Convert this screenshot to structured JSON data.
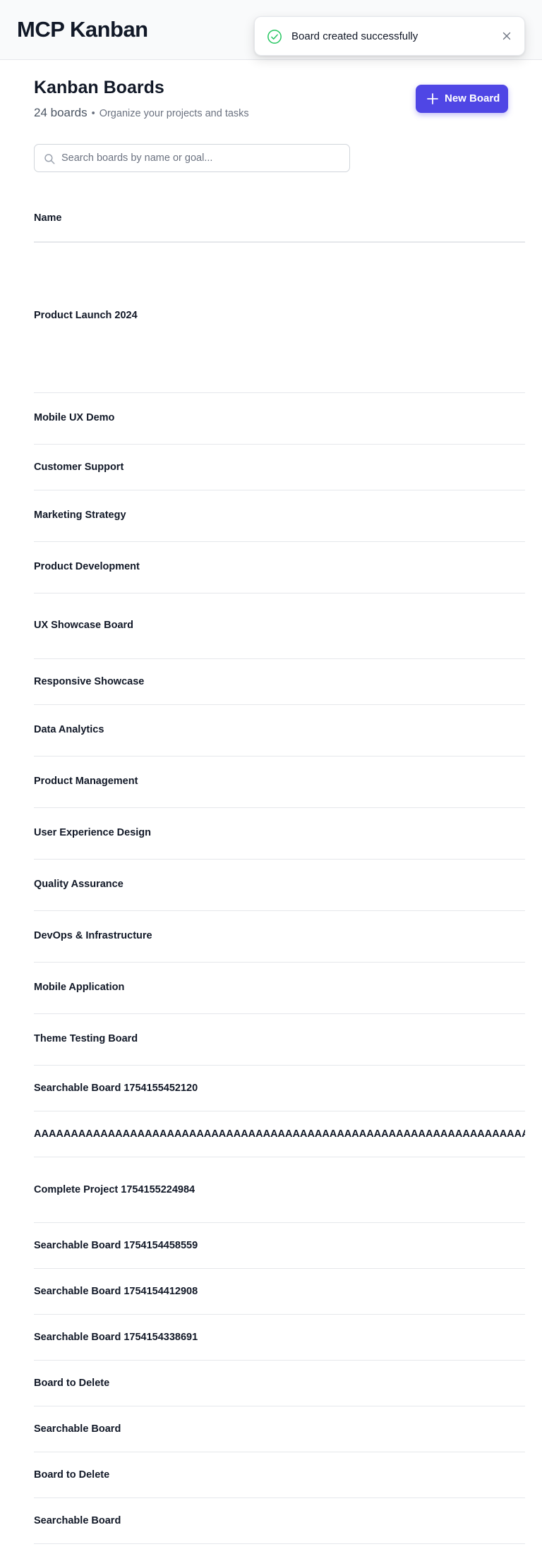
{
  "app": {
    "title": "MCP Kanban"
  },
  "toast": {
    "message": "Board created successfully",
    "status_color": "#22c55e"
  },
  "page": {
    "heading": "Kanban Boards",
    "board_count": "24 boards",
    "separator": "•",
    "tagline": "Organize your projects and tasks",
    "new_board_label": "New Board",
    "accent_color": "#4f46e5"
  },
  "search": {
    "placeholder": "Search boards by name or goal...",
    "value": ""
  },
  "table": {
    "column_header": "Name",
    "rows": [
      "Product Launch 2024",
      "Mobile UX Demo",
      "Customer Support",
      "Marketing Strategy",
      "Product Development",
      "UX Showcase Board",
      "Responsive Showcase",
      "Data Analytics",
      "Product Management",
      "User Experience Design",
      "Quality Assurance",
      "DevOps & Infrastructure",
      "Mobile Application",
      "Theme Testing Board",
      "Searchable Board 1754155452120",
      "AAAAAAAAAAAAAAAAAAAAAAAAAAAAAAAAAAAAAAAAAAAAAAAAAAAAAAAAAAAAAAAAAAAAAAAAAAAA",
      "Complete Project 1754155224984",
      "Searchable Board 1754154458559",
      "Searchable Board 1754154412908",
      "Searchable Board 1754154338691",
      "Board to Delete",
      "Searchable Board",
      "Board to Delete",
      "Searchable Board"
    ]
  }
}
